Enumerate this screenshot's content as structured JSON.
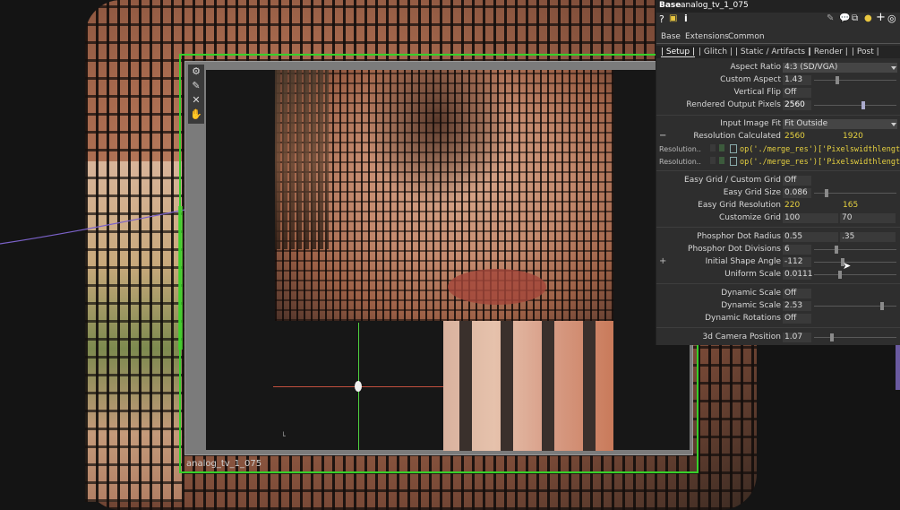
{
  "node": {
    "name": "analog_tv_1_075"
  },
  "panel": {
    "family": "Base",
    "name": "analog_tv_1_075",
    "header_icons": [
      "help-icon",
      "python-icon",
      "info-icon"
    ],
    "header_right_icons": [
      "pencil-icon",
      "comment-icon",
      "clone-icon",
      "python-icon",
      "plus-icon",
      "gear-icon"
    ],
    "tabs_top": [
      "Base",
      "Extensions",
      "Common"
    ],
    "tabs_page": [
      "| Setup |",
      "| Glitch |",
      "| Static / Artifacts |",
      "| Render |",
      "| Post |"
    ],
    "params": {
      "aspect_ratio": {
        "label": "Aspect Ratio",
        "value": "4:3 (SD/VGA)"
      },
      "custom_aspect": {
        "label": "Custom Aspect",
        "value": "1.43"
      },
      "vertical_flip": {
        "label": "Vertical Flip",
        "value": "Off"
      },
      "rendered_output": {
        "label": "Rendered Output Pixels",
        "value": "2560"
      },
      "input_fit": {
        "label": "Input Image Fit",
        "value": "Fit Outside"
      },
      "resolution_calc": {
        "label": "Resolution Calculated",
        "value1": "2560",
        "value2": "1920"
      },
      "res_expr1": {
        "label": "Resolution..",
        "value": "op('./merge_res')['Pixelswidthlength"
      },
      "res_expr2": {
        "label": "Resolution..",
        "value": "op('./merge_res')['Pixelswidthlength"
      },
      "easy_grid_toggle": {
        "label": "Easy Grid / Custom Grid",
        "value": "Off"
      },
      "easy_grid_size": {
        "label": "Easy Grid Size",
        "value": "0.086"
      },
      "easy_grid_res": {
        "label": "Easy Grid Resolution",
        "value1": "220",
        "value2": "165"
      },
      "customize_grid": {
        "label": "Customize Grid",
        "value1": "100",
        "value2": "70"
      },
      "phosphor_radius": {
        "label": "Phosphor Dot Radius",
        "value1": "0.55",
        "value2": ".35"
      },
      "phosphor_div": {
        "label": "Phosphor Dot Divisions",
        "value": "6"
      },
      "initial_angle": {
        "label": "Initial Shape Angle",
        "value": "-112"
      },
      "uniform_scale": {
        "label": "Uniform Scale",
        "value": "0.0111"
      },
      "dynamic_scale_toggle": {
        "label": "Dynamic Scale",
        "value": "Off"
      },
      "dynamic_scale": {
        "label": "Dynamic Scale",
        "value": "2.53"
      },
      "dynamic_rot": {
        "label": "Dynamic Rotations",
        "value": "Off"
      },
      "camera_pos": {
        "label": "3d Camera Position",
        "value": "1.07"
      }
    },
    "collapse_minus": "−",
    "collapse_plus": "+"
  },
  "colors": {
    "node_border": "#37d12a",
    "highlight_value": "#e6d140",
    "panel_bg": "#2e2e2e"
  }
}
